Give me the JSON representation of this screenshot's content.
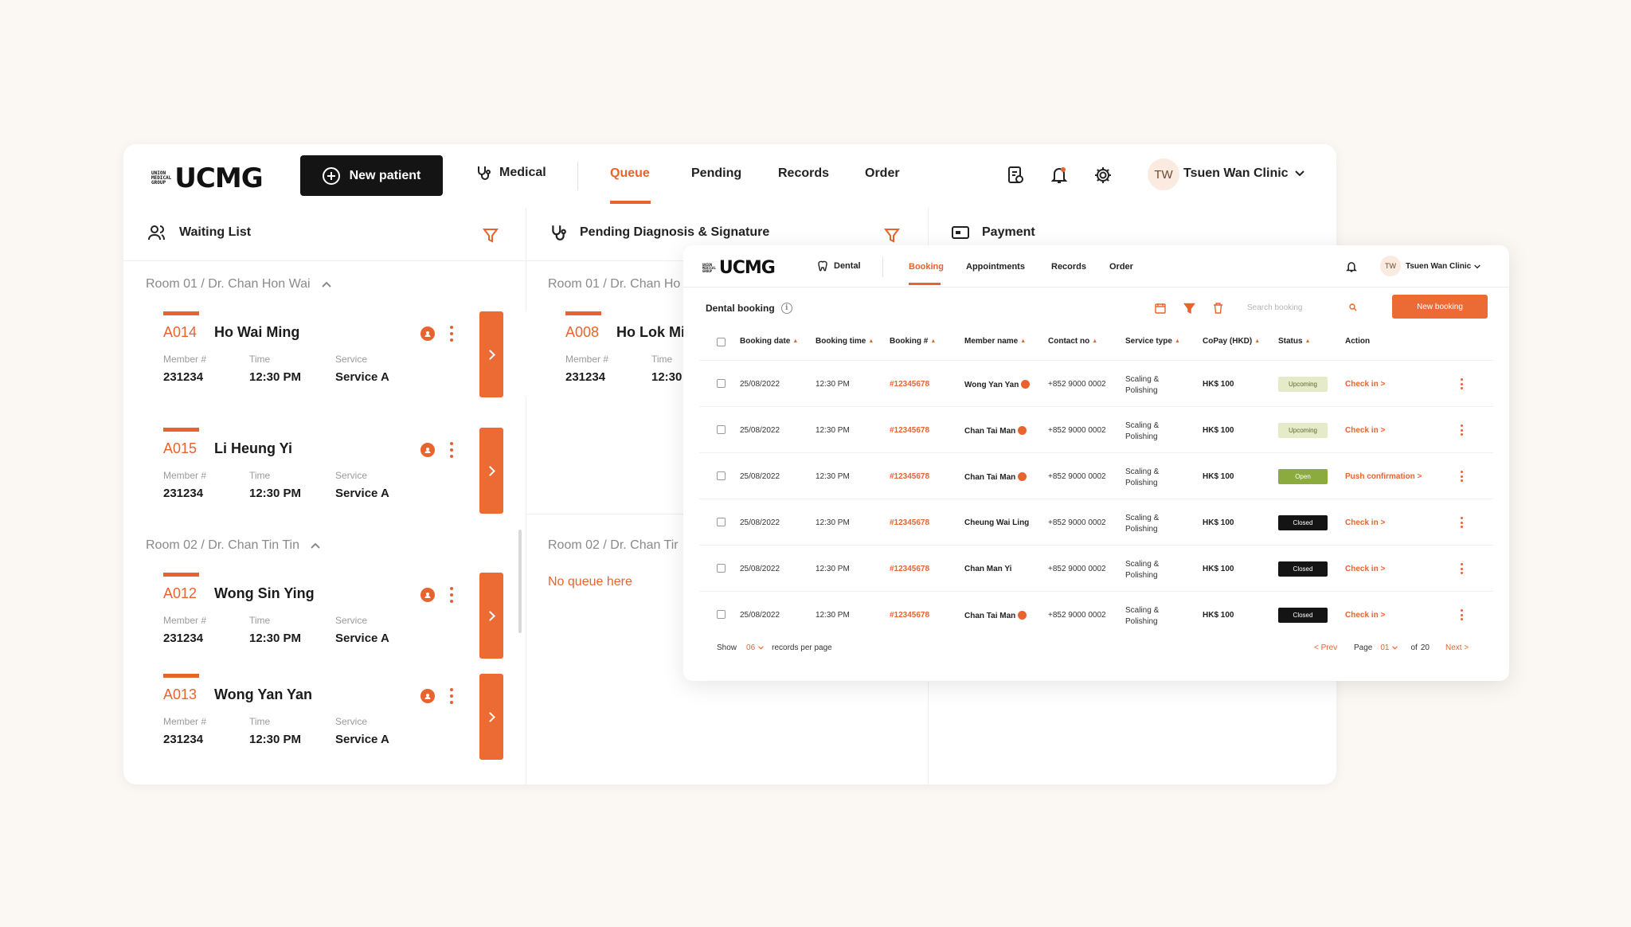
{
  "main": {
    "logo": "UCMG",
    "logo_mark": [
      "UNION",
      "MEDICAL",
      "GROUP"
    ],
    "new_patient_label": "New patient",
    "nav": {
      "medical": "Medical",
      "queue": "Queue",
      "pending": "Pending",
      "records": "Records",
      "order": "Order"
    },
    "user": {
      "initials": "TW",
      "clinic": "Tsuen Wan Clinic"
    },
    "panels": {
      "waiting_list": "Waiting List",
      "pending_diagnosis": "Pending Diagnosis & Signature",
      "payment": "Payment"
    },
    "labels": {
      "member": "Member #",
      "time": "Time",
      "service": "Service"
    },
    "waiting_rooms": [
      {
        "title": "Room 01 / Dr. Chan Hon Wai",
        "cards": [
          {
            "code": "A014",
            "name": "Ho Wai Ming",
            "member": "231234",
            "time": "12:30 PM",
            "service": "Service A"
          },
          {
            "code": "A015",
            "name": "Li Heung Yi",
            "member": "231234",
            "time": "12:30 PM",
            "service": "Service A"
          }
        ]
      },
      {
        "title": "Room 02 / Dr. Chan Tin Tin",
        "cards": [
          {
            "code": "A012",
            "name": "Wong Sin Ying",
            "member": "231234",
            "time": "12:30 PM",
            "service": "Service A"
          },
          {
            "code": "A013",
            "name": "Wong Yan Yan",
            "member": "231234",
            "time": "12:30 PM",
            "service": "Service A"
          }
        ]
      }
    ],
    "pending_rooms": [
      {
        "title": "Room 01 / Dr. Chan Ho",
        "card": {
          "code": "A008",
          "name": "Ho Lok Mi",
          "member": "231234",
          "time": "12:30"
        }
      },
      {
        "title": "Room 02 / Dr. Chan Tir",
        "empty": "No queue here"
      }
    ]
  },
  "dental": {
    "logo": "UCMG",
    "nav": {
      "dental": "Dental",
      "booking": "Booking",
      "appointments": "Appointments",
      "records": "Records",
      "order": "Order"
    },
    "user": {
      "initials": "TW",
      "clinic": "Tsuen Wan Clinic"
    },
    "title": "Dental booking",
    "search_placeholder": "Search booking",
    "new_booking": "New booking",
    "columns": [
      "Booking date",
      "Booking time",
      "Booking #",
      "Member name",
      "Contact no",
      "Service type",
      "CoPay (HKD)",
      "Status",
      "Action"
    ],
    "rows": [
      {
        "date": "25/08/2022",
        "time": "12:30 PM",
        "booking": "#12345678",
        "member": "Wong Yan Yan",
        "member_icon": true,
        "contact": "+852 9000 0002",
        "service": "Scaling & Polishing",
        "copay": "HK$ 100",
        "status": "Upcoming",
        "status_kind": "upcoming",
        "action": "Check in >"
      },
      {
        "date": "25/08/2022",
        "time": "12:30 PM",
        "booking": "#12345678",
        "member": "Chan Tai Man",
        "member_icon": true,
        "contact": "+852 9000 0002",
        "service": "Scaling & Polishing",
        "copay": "HK$ 100",
        "status": "Upcoming",
        "status_kind": "upcoming",
        "action": "Check in >"
      },
      {
        "date": "25/08/2022",
        "time": "12:30 PM",
        "booking": "#12345678",
        "member": "Chan Tai Man",
        "member_icon": true,
        "contact": "+852 9000 0002",
        "service": "Scaling & Polishing",
        "copay": "HK$ 100",
        "status": "Open",
        "status_kind": "open",
        "action": "Push confirmation >"
      },
      {
        "date": "25/08/2022",
        "time": "12:30 PM",
        "booking": "#12345678",
        "member": "Cheung Wai Ling",
        "member_icon": false,
        "contact": "+852 9000 0002",
        "service": "Scaling & Polishing",
        "copay": "HK$ 100",
        "status": "Closed",
        "status_kind": "closed",
        "action": "Check in >"
      },
      {
        "date": "25/08/2022",
        "time": "12:30 PM",
        "booking": "#12345678",
        "member": "Chan Man Yi",
        "member_icon": false,
        "contact": "+852 9000 0002",
        "service": "Scaling & Polishing",
        "copay": "HK$ 100",
        "status": "Closed",
        "status_kind": "closed",
        "action": "Check in >"
      },
      {
        "date": "25/08/2022",
        "time": "12:30 PM",
        "booking": "#12345678",
        "member": "Chan Tai Man",
        "member_icon": true,
        "contact": "+852 9000 0002",
        "service": "Scaling & Polishing",
        "copay": "HK$ 100",
        "status": "Closed",
        "status_kind": "closed",
        "action": "Check in >"
      }
    ],
    "footer": {
      "show": "Show",
      "per_page_value": "06",
      "per_page_label": "records per page",
      "prev": "< Prev",
      "page_label": "Page",
      "page_value": "01",
      "of_label": "of",
      "total_pages": "20",
      "next": "Next >"
    }
  },
  "colors": {
    "accent": "#e8632d",
    "dark": "#141414",
    "upcoming": "#e5eac9",
    "open": "#8cab3e"
  }
}
